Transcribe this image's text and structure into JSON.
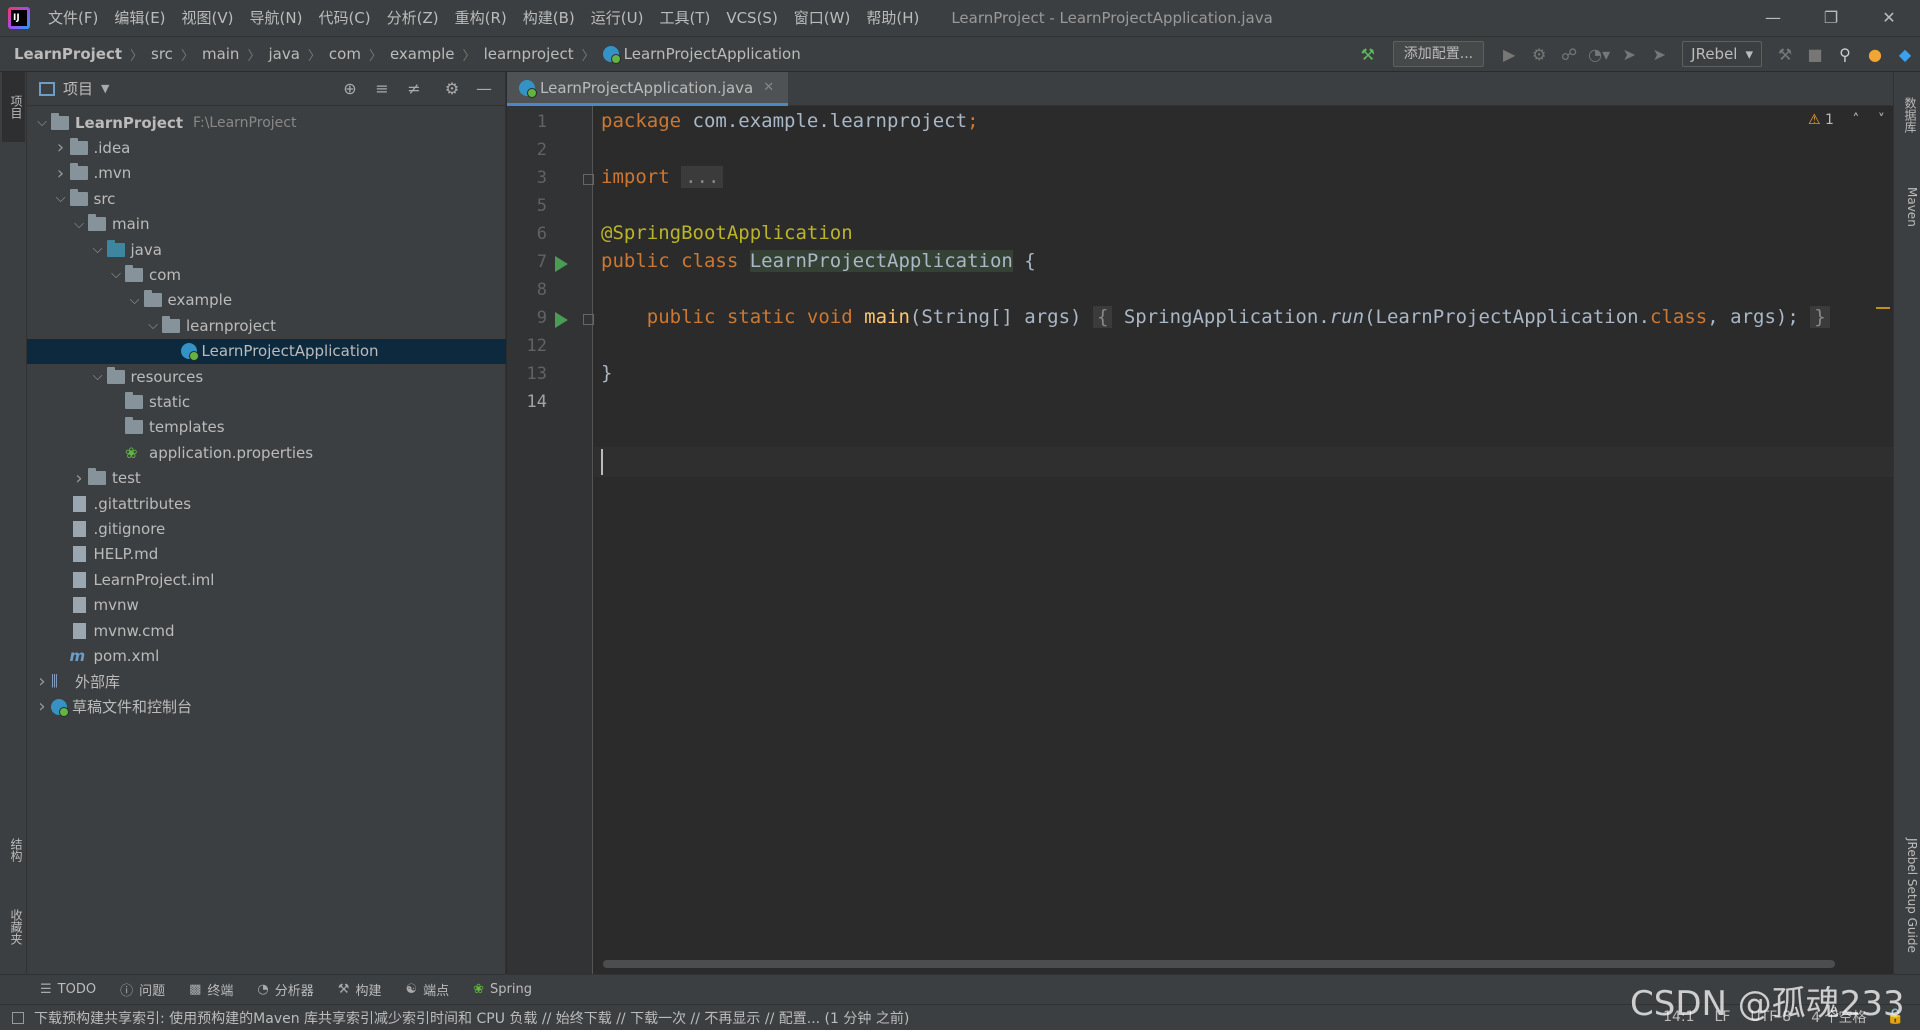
{
  "menu": {
    "items": [
      "文件(F)",
      "编辑(E)",
      "视图(V)",
      "导航(N)",
      "代码(C)",
      "分析(Z)",
      "重构(R)",
      "构建(B)",
      "运行(U)",
      "工具(T)",
      "VCS(S)",
      "窗口(W)",
      "帮助(H)"
    ],
    "window_title": "LearnProject - LearnProjectApplication.java"
  },
  "breadcrumb": [
    "LearnProject",
    "src",
    "main",
    "java",
    "com",
    "example",
    "learnproject",
    "LearnProjectApplication"
  ],
  "toolbar": {
    "add_config": "添加配置...",
    "jrebel": "JRebel"
  },
  "left_strip": {
    "project_tab": "项目",
    "structure_tab": "结构",
    "favorites_tab": "收藏夹"
  },
  "right_strip": {
    "database_tab": "数据库",
    "maven_tab": "Maven",
    "jrebel_tab": "JRebel Setup Guide"
  },
  "project_panel": {
    "title": "项目",
    "tree": [
      {
        "label": "LearnProject",
        "extra": "F:\\LearnProject",
        "depth": 0,
        "arrow": "▼",
        "icon": "module-folder",
        "bold": true
      },
      {
        "label": ".idea",
        "depth": 1,
        "arrow": "▶",
        "icon": "folder"
      },
      {
        "label": ".mvn",
        "depth": 1,
        "arrow": "▶",
        "icon": "folder"
      },
      {
        "label": "src",
        "depth": 1,
        "arrow": "▼",
        "icon": "folder"
      },
      {
        "label": "main",
        "depth": 2,
        "arrow": "▼",
        "icon": "folder"
      },
      {
        "label": "java",
        "depth": 3,
        "arrow": "▼",
        "icon": "source-folder"
      },
      {
        "label": "com",
        "depth": 4,
        "arrow": "▼",
        "icon": "package"
      },
      {
        "label": "example",
        "depth": 5,
        "arrow": "▼",
        "icon": "package"
      },
      {
        "label": "learnproject",
        "depth": 6,
        "arrow": "▼",
        "icon": "package"
      },
      {
        "label": "LearnProjectApplication",
        "depth": 7,
        "arrow": "",
        "icon": "spring-class",
        "selected": true
      },
      {
        "label": "resources",
        "depth": 3,
        "arrow": "▼",
        "icon": "resources-folder"
      },
      {
        "label": "static",
        "depth": 4,
        "arrow": "",
        "icon": "folder"
      },
      {
        "label": "templates",
        "depth": 4,
        "arrow": "",
        "icon": "folder"
      },
      {
        "label": "application.properties",
        "depth": 4,
        "arrow": "",
        "icon": "spring-properties"
      },
      {
        "label": "test",
        "depth": 2,
        "arrow": "▶",
        "icon": "folder"
      },
      {
        "label": ".gitattributes",
        "depth": 1,
        "arrow": "",
        "icon": "file"
      },
      {
        "label": ".gitignore",
        "depth": 1,
        "arrow": "",
        "icon": "file"
      },
      {
        "label": "HELP.md",
        "depth": 1,
        "arrow": "",
        "icon": "markdown-file"
      },
      {
        "label": "LearnProject.iml",
        "depth": 1,
        "arrow": "",
        "icon": "iml-file"
      },
      {
        "label": "mvnw",
        "depth": 1,
        "arrow": "",
        "icon": "file"
      },
      {
        "label": "mvnw.cmd",
        "depth": 1,
        "arrow": "",
        "icon": "file"
      },
      {
        "label": "pom.xml",
        "depth": 1,
        "arrow": "",
        "icon": "maven-file"
      },
      {
        "label": "外部库",
        "depth": 0,
        "arrow": "▶",
        "icon": "library"
      },
      {
        "label": "草稿文件和控制台",
        "depth": 0,
        "arrow": "▶",
        "icon": "scratches"
      }
    ]
  },
  "editor": {
    "tab_label": "LearnProjectApplication.java",
    "line_numbers": [
      "1",
      "2",
      "3",
      "5",
      "6",
      "7",
      "8",
      "9",
      "12",
      "13",
      "14"
    ],
    "warning_count": "1",
    "code": {
      "l1_kw": "package",
      "l1_rest": " com.example.learnproject",
      "l3_kw": "import",
      "l3_fold": "...",
      "l6_ann": "@SpringBootApplication",
      "l7_kw": "public class",
      "l7_cls": "LearnProjectApplication",
      "l7_rest": " {",
      "l9_kw": "public static void",
      "l9_fn": "main",
      "l9_sig": "(String[] args)",
      "l9_body_pre": " SpringApplication.",
      "l9_run": "run",
      "l9_body_post": "(LearnProjectApplication.",
      "l9_class": "class",
      "l9_end": ", args);",
      "l13": "}"
    }
  },
  "bottom_tools": [
    "TODO",
    "问题",
    "终端",
    "分析器",
    "构建",
    "端点",
    "Spring"
  ],
  "status": {
    "message": "下载预构建共享索引: 使用预构建的Maven 库共享索引减少索引时间和 CPU 负载 // 始终下载 // 下载一次 // 不再显示 // 配置... (1 分钟 之前)",
    "position": "14:1",
    "line_sep": "LF",
    "encoding": "UTF-8",
    "indent": "4 个空格"
  },
  "watermark": "CSDN @孤魂233"
}
